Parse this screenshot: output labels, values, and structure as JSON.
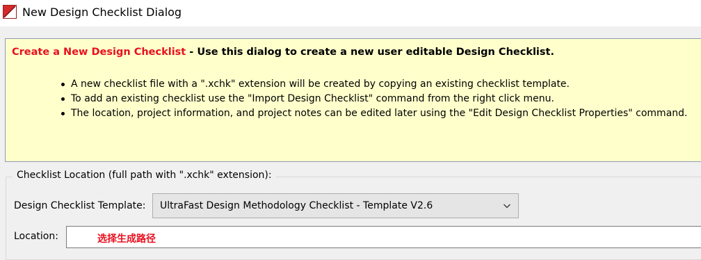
{
  "window": {
    "title": "New Design Checklist Dialog",
    "icon": "vivado-logo-icon"
  },
  "banner": {
    "heading_red": "Create a New Design Checklist",
    "heading_rest": " - Use this dialog to create a new user editable Design Checklist.",
    "bullets": [
      "A new checklist file with a \".xchk\" extension will be created by copying an existing checklist template.",
      "To add an existing checklist use the \"Import Design Checklist\" command from the right click menu.",
      "The location, project information, and project notes can be edited later using the \"Edit Design Checklist Properties\" command."
    ]
  },
  "location_group": {
    "legend": "Checklist Location (full path with \".xchk\" extension):",
    "template_label": "Design Checklist Template:",
    "template_value": "UltraFast Design Methodology Checklist - Template V2.6",
    "location_label": "Location:",
    "location_value": "",
    "annotation": "选择生成路径"
  },
  "colors": {
    "banner_bg": "#ffffcc",
    "heading_red": "#e8101f",
    "annotation_red": "#e8101f"
  }
}
